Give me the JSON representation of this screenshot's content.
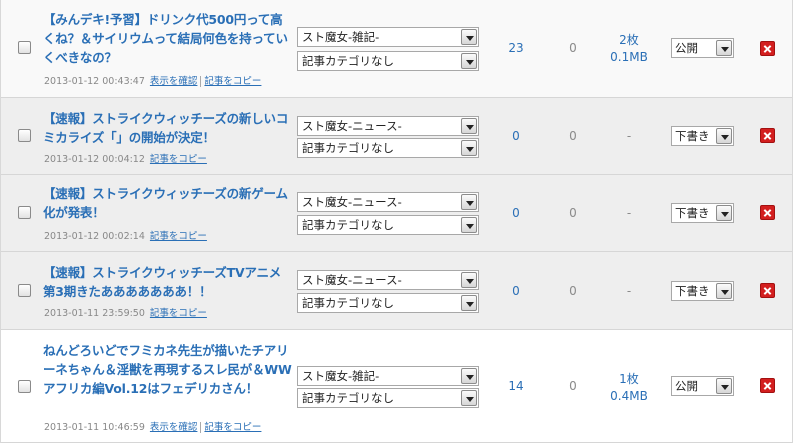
{
  "posts": [
    {
      "title": "【みんデキ!予習】ドリンク代500円って高くね？＆サイリウムって結局何色を持っていくべきなの？",
      "date": "2013-01-12 00:43:47",
      "links": [
        "表示を確認",
        "記事をコピー"
      ],
      "category": "スト魔女-雑記-",
      "subcategory": "記事カテゴリなし",
      "count_a": "23",
      "count_b": "0",
      "images": [
        "2枚",
        "0.1MB"
      ],
      "status": "公開"
    },
    {
      "title": "【速報】ストライクウィッチーズの新しいコミカライズ「」の開始が決定！",
      "date": "2013-01-12 00:04:12",
      "links": [
        "記事をコピー"
      ],
      "category": "スト魔女-ニュース-",
      "subcategory": "記事カテゴリなし",
      "count_a": "0",
      "count_b": "0",
      "images": [
        "-"
      ],
      "status": "下書き"
    },
    {
      "title": "【速報】ストライクウィッチーズの新ゲーム化が発表！",
      "date": "2013-01-12 00:02:14",
      "links": [
        "記事をコピー"
      ],
      "category": "スト魔女-ニュース-",
      "subcategory": "記事カテゴリなし",
      "count_a": "0",
      "count_b": "0",
      "images": [
        "-"
      ],
      "status": "下書き"
    },
    {
      "title": "【速報】ストライクウィッチーズTVアニメ第3期きたあああああああ！！",
      "date": "2013-01-11 23:59:50",
      "links": [
        "記事をコピー"
      ],
      "category": "スト魔女-ニュース-",
      "subcategory": "記事カテゴリなし",
      "count_a": "0",
      "count_b": "0",
      "images": [
        "-"
      ],
      "status": "下書き"
    },
    {
      "title": "ねんどろいどでフミカネ先生が描いたチアリーネちゃん＆淫獣を再現するスレ民が＆WWアフリカ編Vol.12はフェデリカさん！",
      "date": "2013-01-11 10:46:59",
      "links": [
        "表示を確認",
        "記事をコピー"
      ],
      "category": "スト魔女-雑記-",
      "subcategory": "記事カテゴリなし",
      "count_a": "14",
      "count_b": "0",
      "images": [
        "1枚",
        "0.4MB"
      ],
      "status": "公開"
    }
  ]
}
